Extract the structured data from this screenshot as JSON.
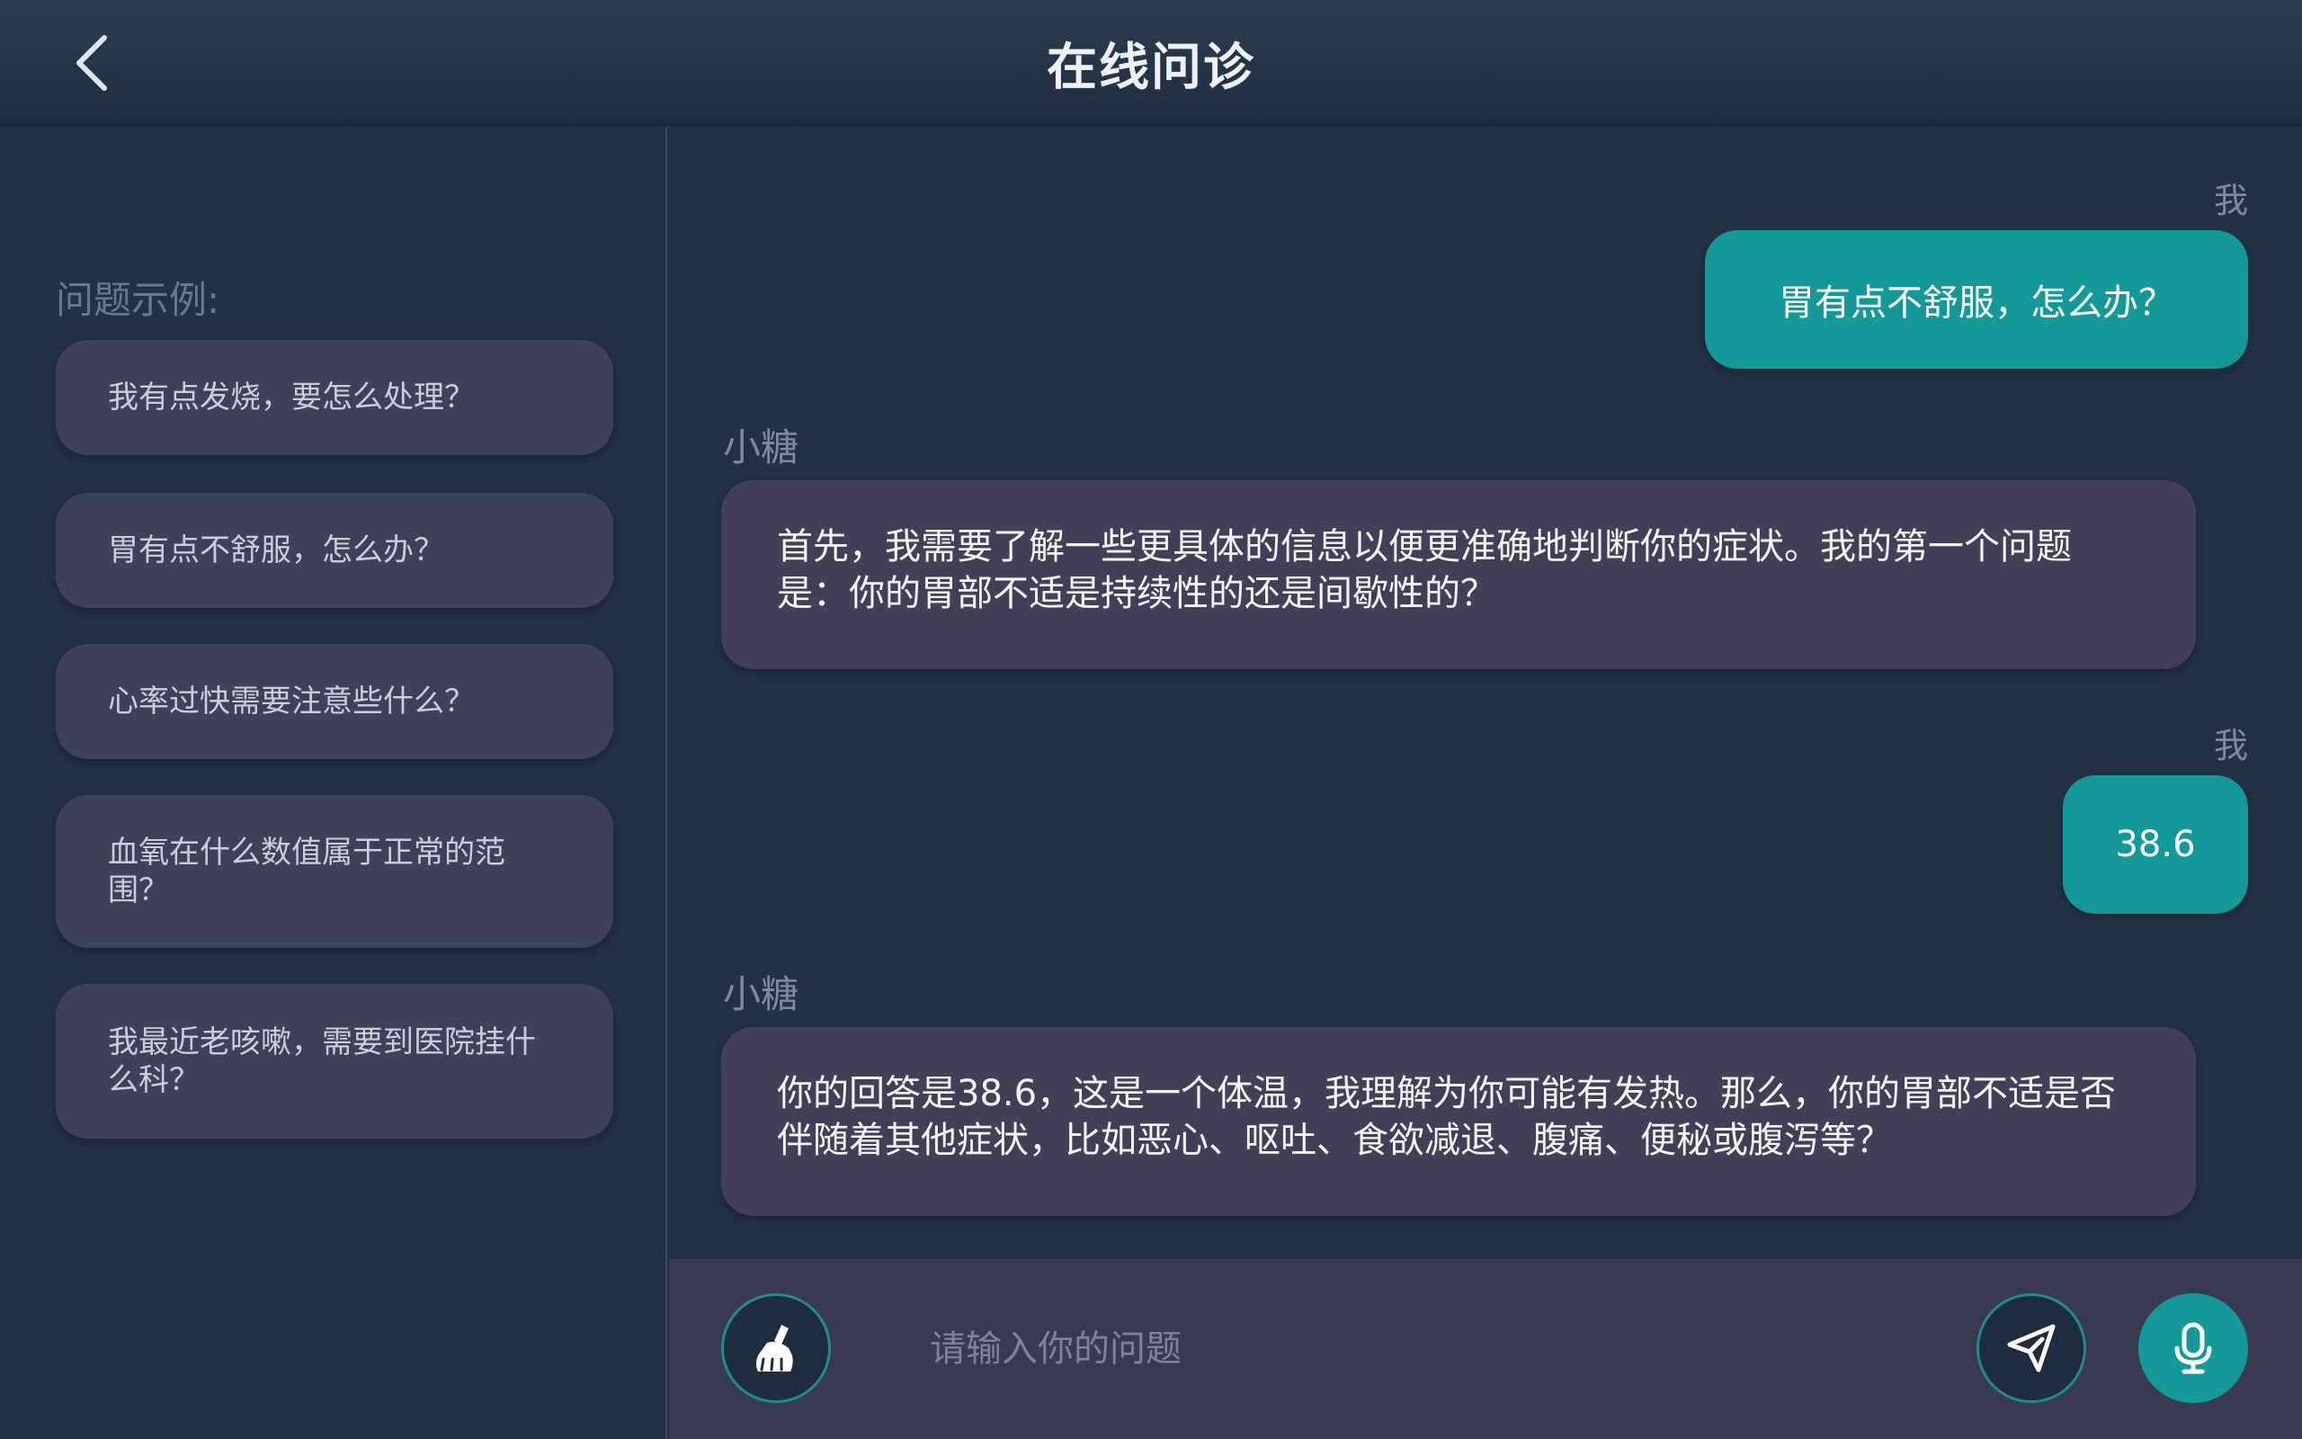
{
  "header": {
    "title": "在线问诊",
    "back_icon": "chevron-left-icon"
  },
  "examples": {
    "title": "问题示例:",
    "items": [
      "我有点发烧，要怎么处理？",
      "胃有点不舒服，怎么办？",
      "心率过快需要注意些什么？",
      "血氧在什么数值属于正常的范围？",
      "我最近老咳嗽，需要到医院挂什么科？"
    ]
  },
  "chat": {
    "messages": [
      {
        "role": "me",
        "sender": "我",
        "text": "胃有点不舒服，怎么办？"
      },
      {
        "role": "bot",
        "sender": "小糖",
        "text": "首先，我需要了解一些更具体的信息以便更准确地判断你的症状。我的第一个问题是：你的胃部不适是持续性的还是间歇性的？"
      },
      {
        "role": "me",
        "sender": "我",
        "text": "38.6"
      },
      {
        "role": "bot",
        "sender": "小糖",
        "text": "你的回答是38.6，这是一个体温，我理解为你可能有发热。那么，你的胃部不适是否伴随着其他症状，比如恶心、呕吐、食欲减退、腹痛、便秘或腹泻等？"
      }
    ]
  },
  "input": {
    "placeholder": "请输入你的问题",
    "value": "",
    "clear_icon": "broom-icon",
    "send_icon": "send-icon",
    "voice_icon": "microphone-icon"
  },
  "colors": {
    "background": "#233143",
    "accent": "#139a98",
    "user_bubble": "#139a98",
    "bot_bubble": "#433f56",
    "example_card": "#3d4256",
    "input_bar": "#393a4f"
  }
}
